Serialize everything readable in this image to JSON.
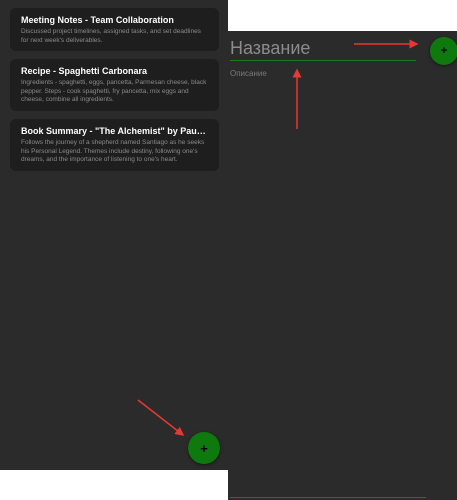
{
  "notes_list": {
    "items": [
      {
        "title": "Meeting Notes - Team Collaboration",
        "body": "Discussed project timelines, assigned tasks, and set deadlines for next week's deliverables."
      },
      {
        "title": "Recipe - Spaghetti Carbonara",
        "body": "Ingredients - spaghetti, eggs, pancetta, Parmesan cheese, black pepper. Steps - cook spaghetti, fry pancetta, mix eggs and cheese, combine all ingredients."
      },
      {
        "title": "Book Summary - \"The Alchemist\" by Paulo Coelho",
        "body": "Follows the journey of a shepherd named Santiago as he seeks his Personal Legend. Themes include destiny, following one's dreams, and the importance of listening to one's heart."
      }
    ],
    "fab_label": "+"
  },
  "editor": {
    "title_placeholder": "Название",
    "description_placeholder": "Описание",
    "fab_label": "+"
  },
  "colors": {
    "background": "#2b2b2b",
    "card": "#1e1e1e",
    "accent_green": "#0e7a0e",
    "annotation_arrow": "#e53935"
  }
}
